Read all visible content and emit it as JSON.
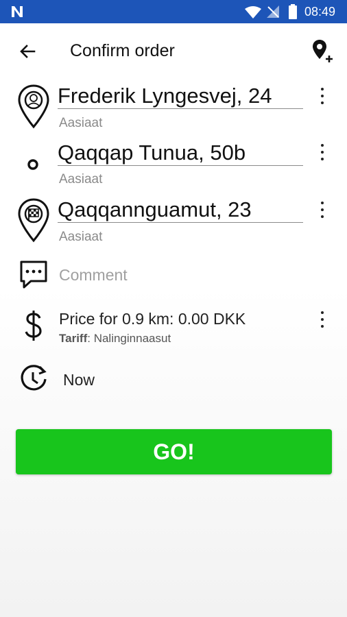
{
  "status_bar": {
    "time": "08:49",
    "color": "#1d55b8",
    "icons": [
      "app-logo-icon",
      "wifi-icon",
      "no-signal-icon",
      "battery-icon"
    ]
  },
  "app_bar": {
    "title": "Confirm order",
    "back_icon": "arrow-back-icon",
    "add_stop_icon": "add-location-icon"
  },
  "route": {
    "pickup": {
      "address": "Frederik Lyngesvej, 24",
      "city": "Aasiaat",
      "icon": "pin-person-icon"
    },
    "stop": {
      "address": "Qaqqap Tunua, 50b",
      "city": "Aasiaat",
      "icon": "waypoint-dot-icon"
    },
    "destination": {
      "address": "Qaqqannguamut, 23",
      "city": "Aasiaat",
      "icon": "pin-flag-icon"
    }
  },
  "comment": {
    "placeholder": "Comment",
    "icon": "comment-icon"
  },
  "price": {
    "text": "Price for 0.9 km: 0.00 DKK",
    "tariff_label": "Tariff",
    "tariff_value": ": Nalinginnaasut",
    "icon": "dollar-icon"
  },
  "time": {
    "text": "Now",
    "icon": "clock-history-icon"
  },
  "go_button": {
    "label": "GO!",
    "color": "#18c51c"
  }
}
